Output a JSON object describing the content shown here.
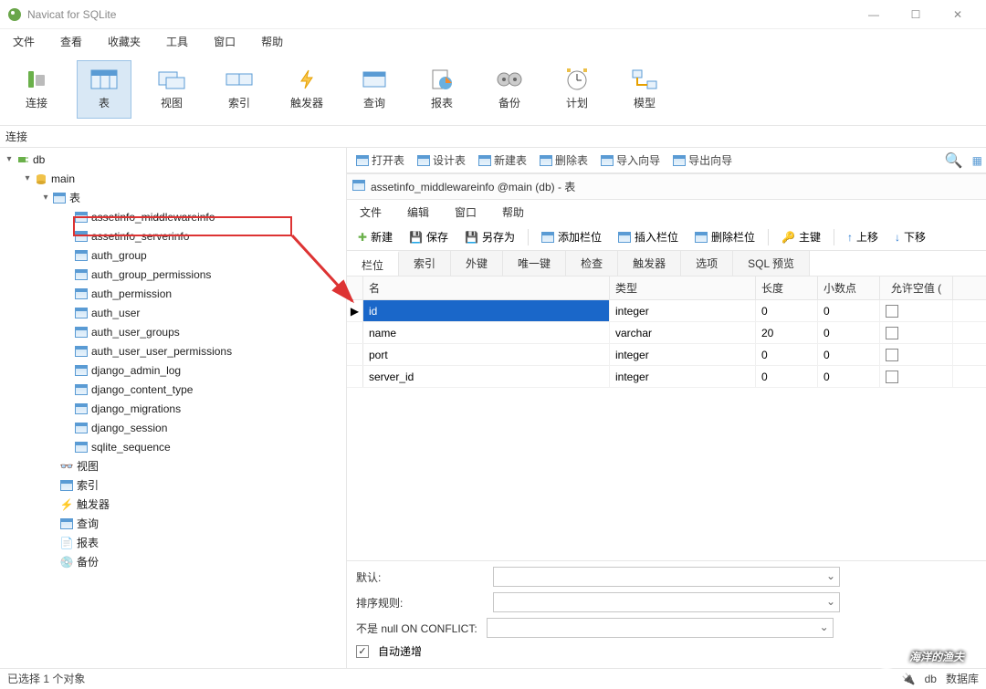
{
  "app": {
    "title": "Navicat for SQLite"
  },
  "win_controls": {
    "min": "—",
    "max": "☐",
    "close": "✕"
  },
  "menu": {
    "file": "文件",
    "view": "查看",
    "fav": "收藏夹",
    "tools": "工具",
    "window": "窗口",
    "help": "帮助"
  },
  "toolbar": {
    "connect": "连接",
    "table": "表",
    "view": "视图",
    "index": "索引",
    "trigger": "触发器",
    "query": "查询",
    "report": "报表",
    "backup": "备份",
    "plan": "计划",
    "model": "模型"
  },
  "conn_label": "连接",
  "tree": {
    "db": "db",
    "main": "main",
    "tables_node": "表",
    "tables": [
      "assetinfo_middlewareinfo",
      "assetinfo_serverinfo",
      "auth_group",
      "auth_group_permissions",
      "auth_permission",
      "auth_user",
      "auth_user_groups",
      "auth_user_user_permissions",
      "django_admin_log",
      "django_content_type",
      "django_migrations",
      "django_session",
      "sqlite_sequence"
    ],
    "nodes": {
      "view": "视图",
      "index": "索引",
      "trigger": "触发器",
      "query": "查询",
      "report": "报表",
      "backup": "备份"
    }
  },
  "rt_toolbar": {
    "open": "打开表",
    "design": "设计表",
    "new": "新建表",
    "delete": "删除表",
    "import": "导入向导",
    "export": "导出向导"
  },
  "subwin": {
    "title": "assetinfo_middlewareinfo @main (db) - 表",
    "menu": {
      "file": "文件",
      "edit": "编辑",
      "window": "窗口",
      "help": "帮助"
    },
    "toolbar": {
      "new": "新建",
      "save": "保存",
      "saveas": "另存为",
      "addcol": "添加栏位",
      "inscol": "插入栏位",
      "delcol": "删除栏位",
      "pk": "主键",
      "up": "上移",
      "down": "下移"
    },
    "tabs": {
      "cols": "栏位",
      "index": "索引",
      "fk": "外键",
      "unique": "唯一键",
      "check": "检查",
      "trigger": "触发器",
      "opts": "选项",
      "sqlpre": "SQL 预览"
    },
    "gridhead": {
      "name": "名",
      "type": "类型",
      "len": "长度",
      "dec": "小数点",
      "null": "允许空值 ("
    },
    "rows": [
      {
        "name": "id",
        "type": "integer",
        "len": "0",
        "dec": "0"
      },
      {
        "name": "name",
        "type": "varchar",
        "len": "20",
        "dec": "0"
      },
      {
        "name": "port",
        "type": "integer",
        "len": "0",
        "dec": "0"
      },
      {
        "name": "server_id",
        "type": "integer",
        "len": "0",
        "dec": "0"
      }
    ],
    "form": {
      "default": "默认:",
      "collation": "排序规则:",
      "onconflict": "不是 null ON CONFLICT:",
      "autoinc": "自动递增"
    }
  },
  "statusbar": {
    "sel": "已选择 1 个对象",
    "db": "db",
    "data": "数据库"
  },
  "watermark": "海洋的渔夫"
}
